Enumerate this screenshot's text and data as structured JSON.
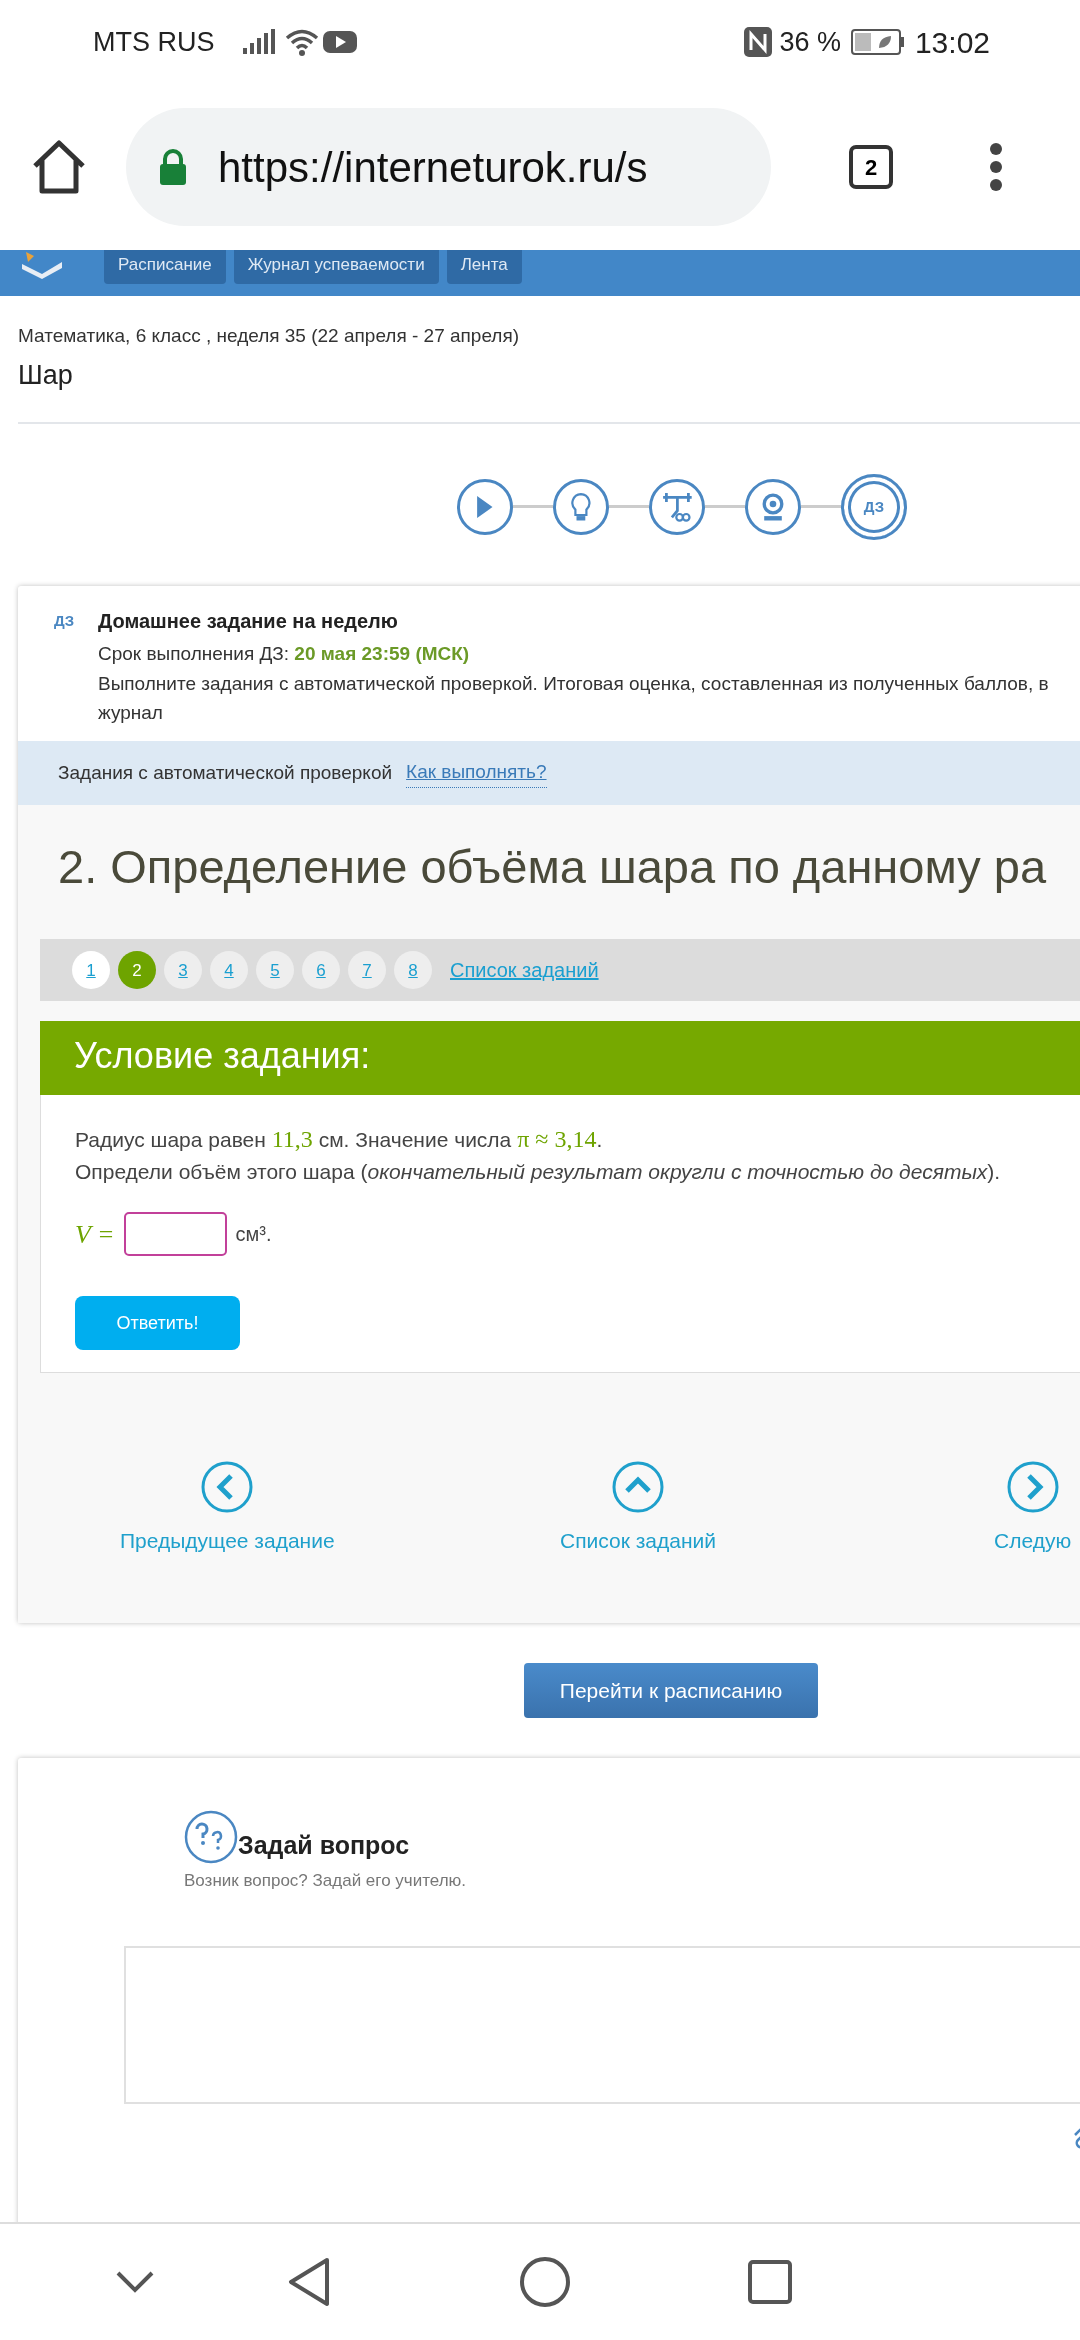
{
  "status_bar": {
    "carrier": "MTS RUS",
    "battery": "36 %",
    "time": "13:02"
  },
  "browser": {
    "url": "https://interneturok.ru/s",
    "tab_count": "2"
  },
  "site_nav": [
    "Расписание",
    "Журнал успеваемости",
    "Лента"
  ],
  "lesson": {
    "breadcrumb": "Математика, 6 класс , неделя 35 (22 апреля - 27 апреля)",
    "title": "Шар"
  },
  "steps": [
    {
      "kind": "video",
      "selected": false
    },
    {
      "kind": "theory",
      "selected": false
    },
    {
      "kind": "trainer",
      "selected": false
    },
    {
      "kind": "webinar",
      "selected": false
    },
    {
      "kind": "homework",
      "label": "ДЗ",
      "selected": true
    }
  ],
  "homework": {
    "badge": "ДЗ",
    "title": "Домашнее задание на неделю",
    "deadline_label": "Срок выполнения ДЗ: ",
    "deadline": "20 мая 23:59 (МСК)",
    "description": "Выполните задания с автоматической проверкой. Итоговая оценка, составленная из полученных баллов, в журнал"
  },
  "auto_check": {
    "label": "Задания с автоматической проверкой",
    "help_link": "Как выполнять?"
  },
  "task": {
    "heading": "2. Определение объёма шара по данному ра",
    "pager": [
      {
        "label": "1",
        "selected": false
      },
      {
        "label": "2",
        "selected": true
      },
      {
        "label": "3",
        "selected": false
      },
      {
        "label": "4",
        "selected": false
      },
      {
        "label": "5",
        "selected": false
      },
      {
        "label": "6",
        "selected": false
      },
      {
        "label": "7",
        "selected": false
      },
      {
        "label": "8",
        "selected": false
      }
    ],
    "list_link": "Список заданий",
    "condition_title": "Условие задания:",
    "statement": [
      {
        "kind": "text",
        "text": "Радиус шара равен "
      },
      {
        "kind": "math",
        "text": "11,3"
      },
      {
        "kind": "text",
        "text": " см. Значение числа "
      },
      {
        "kind": "math",
        "text": "π ≈ 3,14"
      },
      {
        "kind": "text",
        "text": "."
      }
    ],
    "instruction": "Определи объём этого шара (*окончательный результат округли с точностью до десятых*).",
    "answer": {
      "variable": "V =",
      "unit": "см³."
    },
    "submit": "Ответить!"
  },
  "task_nav": [
    {
      "kind": "prev",
      "label": "Предыдущее задание"
    },
    {
      "kind": "list",
      "label": "Список заданий"
    },
    {
      "kind": "next",
      "label": "Следую"
    }
  ],
  "schedule_button": "Перейти к расписанию",
  "question": {
    "title": "Задай вопрос",
    "subtitle": "Возник вопрос? Задай его учителю."
  }
}
